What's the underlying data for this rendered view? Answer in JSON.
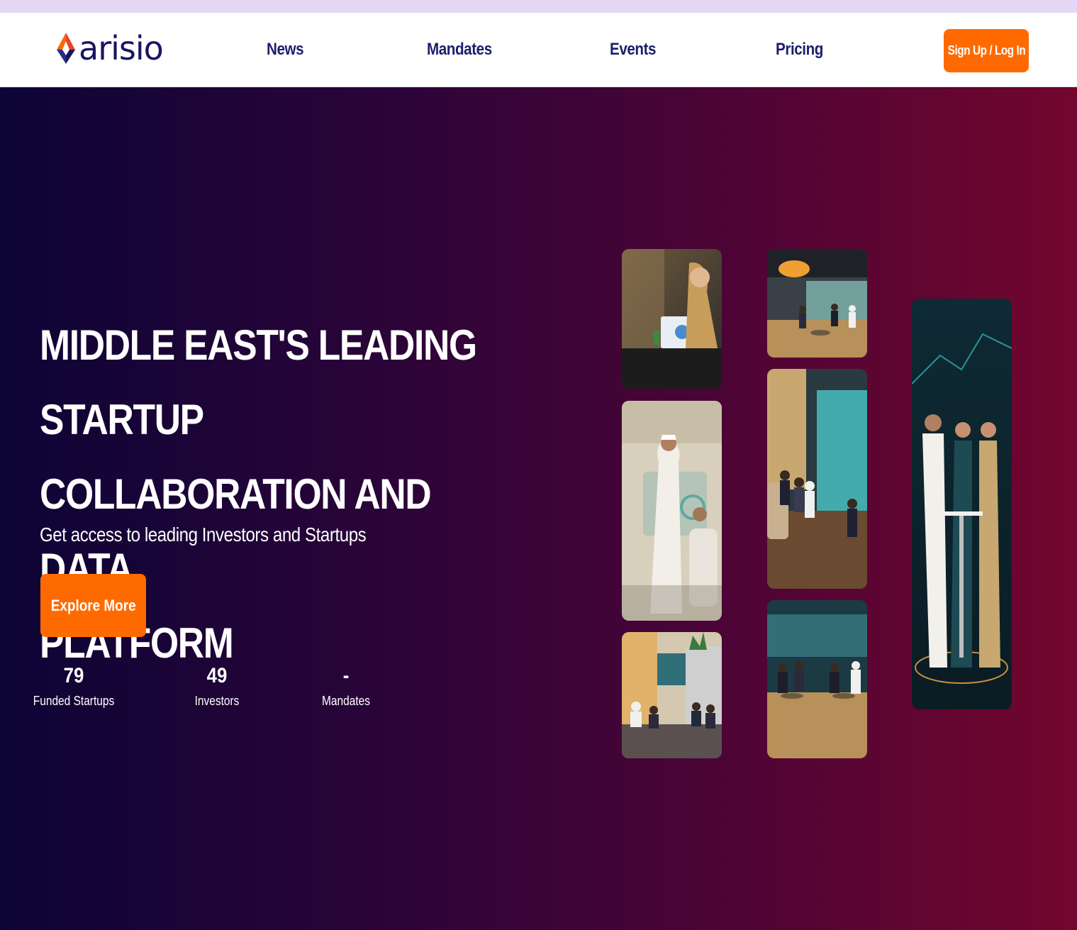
{
  "brand": {
    "name": "arisio",
    "logo_text": "arisio"
  },
  "nav": {
    "links": [
      {
        "label": "News"
      },
      {
        "label": "Mandates"
      },
      {
        "label": "Events"
      },
      {
        "label": "Pricing"
      }
    ],
    "signup_label": "Sign Up / Log In"
  },
  "hero": {
    "headline_lines": [
      "MIDDLE EAST'S LEADING STARTUP",
      "COLLABORATION AND DATA",
      "PLATFORM"
    ],
    "subtitle": "Get access to leading Investors and Startups",
    "cta_label": "Explore More",
    "stats": [
      {
        "value": "79",
        "label": "Funded Startups"
      },
      {
        "value": "49",
        "label": "Investors"
      },
      {
        "value": "-",
        "label": "Mandates"
      }
    ]
  },
  "colors": {
    "accent": "#ff6a00",
    "nav_text": "#1b1f6b",
    "top_strip": "#e4d6f4",
    "hero_gradient_start": "#0d0436",
    "hero_gradient_end": "#72062e"
  },
  "gallery": {
    "images": [
      {
        "name": "laptop-meeting-photo"
      },
      {
        "name": "expo-hall-photo"
      },
      {
        "name": "presenter-photo"
      },
      {
        "name": "panel-audience-photo"
      },
      {
        "name": "lounge-discussion-photo"
      },
      {
        "name": "networking-tables-photo"
      },
      {
        "name": "business-talk-photo"
      }
    ]
  }
}
